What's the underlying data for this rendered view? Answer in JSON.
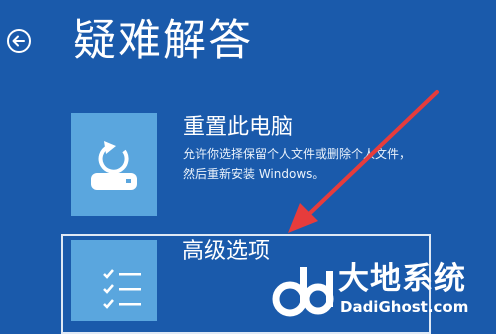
{
  "header": {
    "title": "疑难解答",
    "back_icon": "arrow-left-circle-icon"
  },
  "options": [
    {
      "title": "重置此电脑",
      "description": "允许你选择保留个人文件或删除个人文件，然后重新安装 Windows。",
      "icon": "reset-pc-icon"
    },
    {
      "title": "高级选项",
      "icon": "checklist-icon"
    }
  ],
  "watermark": {
    "name": "大地系统",
    "url": "DadiGhost.com"
  },
  "colors": {
    "background": "#1a5aab",
    "tile": "#5aa6de",
    "arrow": "#e63c3c"
  }
}
